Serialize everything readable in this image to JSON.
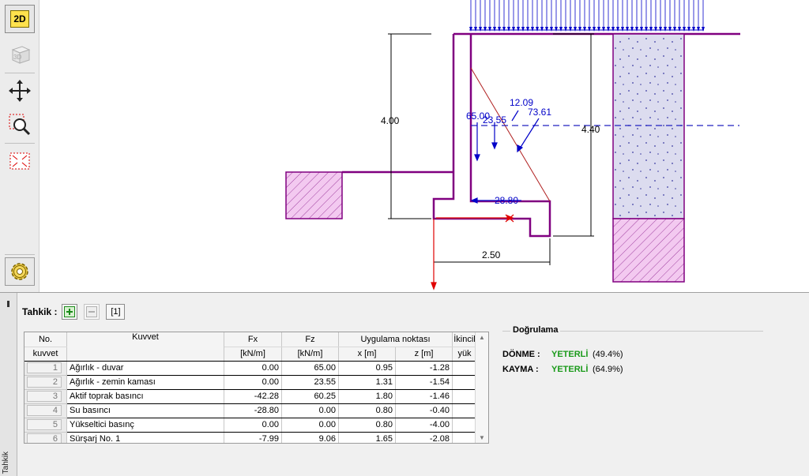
{
  "toolbar": {
    "btn_2d": "2D",
    "btn_3d": "3D"
  },
  "drawing": {
    "dim_height_left": "4.00",
    "dim_height_right": "4.40",
    "dim_base": "2.50",
    "force_labels": [
      "12.09",
      "73.61",
      "65.00",
      "23.55",
      "28.80"
    ],
    "colors": {
      "wall": "#800080",
      "force": "#0000c8",
      "reaction": "#e00000",
      "fill": "#f0c8f0",
      "dotted_fill": "#d8d8f0"
    }
  },
  "panel": {
    "side_tab_label": "Tahkik",
    "tahkik_label": "Tahkik :",
    "page_indicator": "[1]",
    "table": {
      "headers": {
        "no_1": "No.",
        "no_2": "kuvvet",
        "force": "Kuvvet",
        "fx_1": "Fx",
        "fx_2": "[kN/m]",
        "fz_1": "Fz",
        "fz_2": "[kN/m]",
        "app": "Uygulama noktası",
        "x": "x [m]",
        "z": "z [m]",
        "sec_1": "İkincil",
        "sec_2": "yük"
      },
      "rows": [
        {
          "no": "1",
          "name": "Ağırlık - duvar",
          "fx": "0.00",
          "fz": "65.00",
          "x": "0.95",
          "z": "-1.28"
        },
        {
          "no": "2",
          "name": "Ağırlık - zemin kaması",
          "fx": "0.00",
          "fz": "23.55",
          "x": "1.31",
          "z": "-1.54"
        },
        {
          "no": "3",
          "name": "Aktif toprak basıncı",
          "fx": "-42.28",
          "fz": "60.25",
          "x": "1.80",
          "z": "-1.46"
        },
        {
          "no": "4",
          "name": "Su basıncı",
          "fx": "-28.80",
          "fz": "0.00",
          "x": "0.80",
          "z": "-0.40"
        },
        {
          "no": "5",
          "name": "Yükseltici basınç",
          "fx": "0.00",
          "fz": "0.00",
          "x": "0.80",
          "z": "-4.00"
        },
        {
          "no": "6",
          "name": "Sürşarj No. 1",
          "fx": "-7.99",
          "fz": "9.06",
          "x": "1.65",
          "z": "-2.08"
        }
      ]
    },
    "check": {
      "title": "Doğrulama",
      "rows": [
        {
          "key": "DÖNME :",
          "status": "YETERLİ",
          "pct": "(49.4%)"
        },
        {
          "key": "KAYMA :",
          "status": "YETERLİ",
          "pct": "(64.9%)"
        }
      ]
    }
  }
}
